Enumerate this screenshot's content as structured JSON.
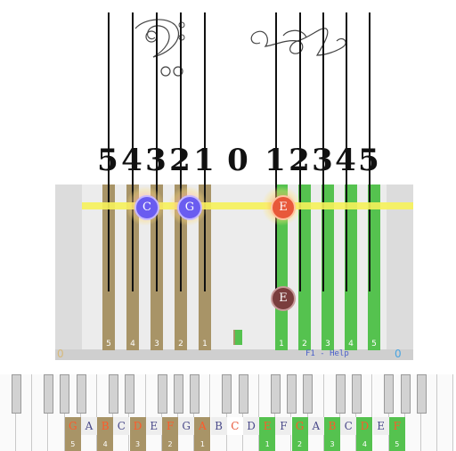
{
  "finger_header": {
    "left": [
      "5",
      "4",
      "3",
      "2",
      "1"
    ],
    "center": "0",
    "right": [
      "1",
      "2",
      "3",
      "4",
      "5"
    ]
  },
  "bars": {
    "left_labels": [
      "5",
      "4",
      "3",
      "2",
      "1"
    ],
    "right_labels": [
      "1",
      "2",
      "3",
      "4",
      "5"
    ]
  },
  "notes": {
    "beam_left_1": "C",
    "beam_left_2": "G",
    "beam_right": "E",
    "lower_right": "E"
  },
  "corners": {
    "left": "0",
    "right": "0"
  },
  "help_text": "F1 - Help",
  "keyboard": {
    "labels": [
      "G",
      "A",
      "B",
      "C",
      "D",
      "E",
      "F",
      "G",
      "A",
      "B",
      "C",
      "D",
      "E",
      "F",
      "G",
      "A",
      "B",
      "C",
      "D",
      "E",
      "F"
    ],
    "fingers_left": [
      "5",
      "4",
      "3",
      "2",
      "1"
    ],
    "fingers_right": [
      "1",
      "2",
      "3",
      "4",
      "5"
    ]
  },
  "colors": {
    "left_bar": "#a89467",
    "right_bar": "#55c24f",
    "beam": "#f6f25a",
    "note_blue": "#6a5cf0",
    "note_red": "#e8583a",
    "note_dark": "#7a3d3d",
    "corner_left": "#d7b97a",
    "corner_right": "#4aa5e0"
  }
}
